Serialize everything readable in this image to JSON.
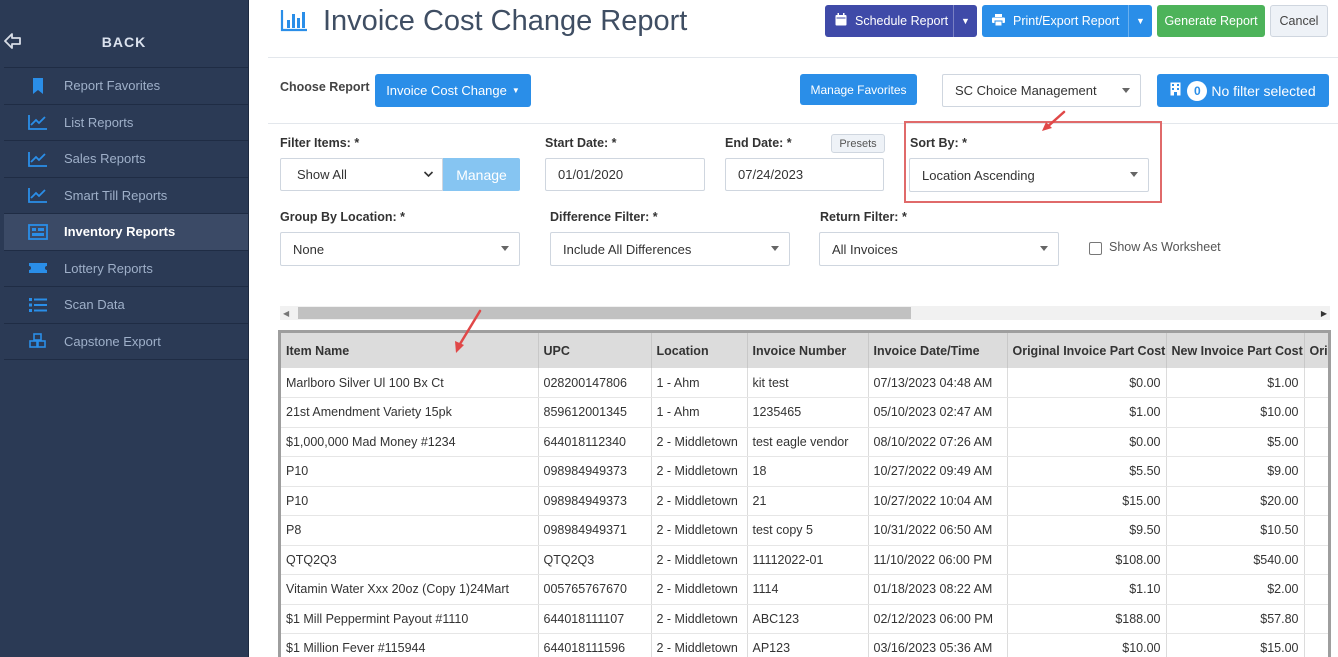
{
  "sidebar": {
    "back_label": "BACK",
    "items": [
      {
        "label": "Report Favorites",
        "icon": "bookmark-icon",
        "active": false
      },
      {
        "label": "List Reports",
        "icon": "line-chart-icon",
        "active": false
      },
      {
        "label": "Sales Reports",
        "icon": "line-chart-icon",
        "active": false
      },
      {
        "label": "Smart Till Reports",
        "icon": "line-chart-icon",
        "active": false
      },
      {
        "label": "Inventory Reports",
        "icon": "inventory-icon",
        "active": true
      },
      {
        "label": "Lottery Reports",
        "icon": "ticket-icon",
        "active": false
      },
      {
        "label": "Scan Data",
        "icon": "list-icon",
        "active": false
      },
      {
        "label": "Capstone Export",
        "icon": "cubes-icon",
        "active": false
      }
    ]
  },
  "header": {
    "title": "Invoice Cost Change Report",
    "schedule_label": "Schedule Report",
    "print_label": "Print/Export Report",
    "generate_label": "Generate Report",
    "cancel_label": "Cancel"
  },
  "controls": {
    "choose_report_label": "Choose Report",
    "choose_report_value": "Invoice Cost Change",
    "manage_favorites_label": "Manage Favorites",
    "organization_value": "SC Choice Management",
    "filter_count": "0",
    "filter_label": "No filter selected"
  },
  "filters": {
    "filter_items_label": "Filter Items: *",
    "filter_items_value": "Show All",
    "manage_label": "Manage",
    "start_date_label": "Start Date: *",
    "start_date_value": "01/01/2020",
    "end_date_label": "End Date: *",
    "end_date_value": "07/24/2023",
    "presets_label": "Presets",
    "sort_by_label": "Sort By: *",
    "sort_by_value": "Location Ascending",
    "group_by_label": "Group By Location: *",
    "group_by_value": "None",
    "difference_label": "Difference Filter: *",
    "difference_value": "Include All Differences",
    "return_label": "Return Filter: *",
    "return_value": "All Invoices",
    "worksheet_label": "Show As Worksheet"
  },
  "table": {
    "headers": [
      "Item Name",
      "UPC",
      "Location",
      "Invoice Number",
      "Invoice Date/Time",
      "Original Invoice Part Cost",
      "New Invoice Part Cost",
      "Orig"
    ],
    "rows": [
      [
        "Marlboro Silver Ul 100 Bx Ct",
        "028200147806",
        "1 - Ahm",
        "kit test",
        "07/13/2023 04:48 AM",
        "$0.00",
        "$1.00"
      ],
      [
        "21st Amendment Variety 15pk",
        "859612001345",
        "1 - Ahm",
        "1235465",
        "05/10/2023 02:47 AM",
        "$1.00",
        "$10.00"
      ],
      [
        "$1,000,000 Mad Money #1234",
        "644018112340",
        "2 - Middletown",
        "test eagle vendor",
        "08/10/2022 07:26 AM",
        "$0.00",
        "$5.00"
      ],
      [
        "P10",
        "098984949373",
        "2 - Middletown",
        "18",
        "10/27/2022 09:49 AM",
        "$5.50",
        "$9.00"
      ],
      [
        "P10",
        "098984949373",
        "2 - Middletown",
        "21",
        "10/27/2022 10:04 AM",
        "$15.00",
        "$20.00"
      ],
      [
        "P8",
        "098984949371",
        "2 - Middletown",
        "test copy 5",
        "10/31/2022 06:50 AM",
        "$9.50",
        "$10.50"
      ],
      [
        "QTQ2Q3",
        "QTQ2Q3",
        "2 - Middletown",
        "11112022-01",
        "11/10/2022 06:00 PM",
        "$108.00",
        "$540.00"
      ],
      [
        "Vitamin Water Xxx 20oz (Copy 1)24Mart",
        "005765767670",
        "2 - Middletown",
        "1114",
        "01/18/2023 08:22 AM",
        "$1.10",
        "$2.00"
      ],
      [
        "$1 Mill Peppermint Payout #1110",
        "644018111107",
        "2 - Middletown",
        "ABC123",
        "02/12/2023 06:00 PM",
        "$188.00",
        "$57.80"
      ],
      [
        "$1 Million Fever #115944",
        "644018111596",
        "2 - Middletown",
        "AP123",
        "03/16/2023 05:36 AM",
        "$10.00",
        "$15.00"
      ]
    ]
  },
  "colors": {
    "sidebar_bg": "#2b3a55",
    "primary": "#2a8ee8",
    "schedule": "#3f4aa8",
    "generate": "#4db35a",
    "annotation": "#e06a6a"
  }
}
